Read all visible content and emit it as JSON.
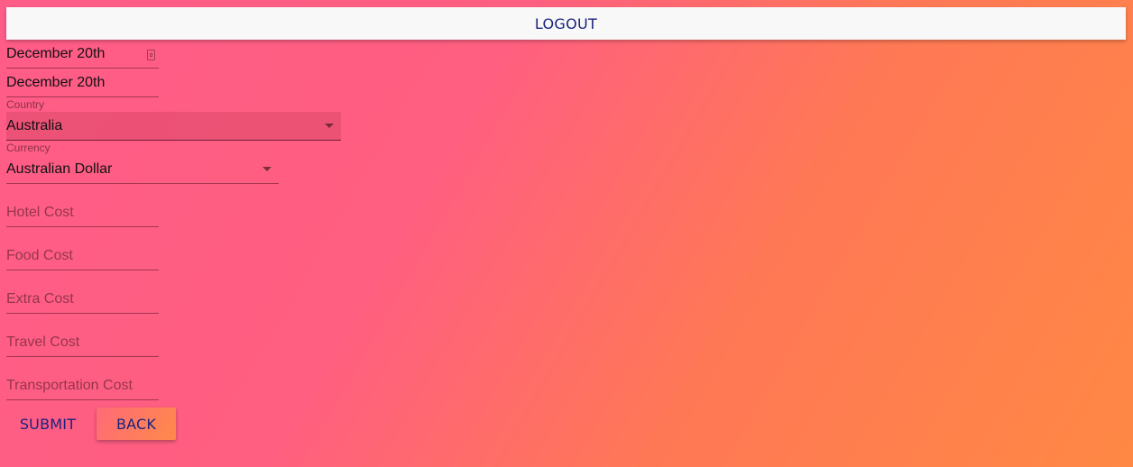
{
  "header": {
    "logout_label": "LOGOUT"
  },
  "form": {
    "start_date": "December 20th",
    "end_date": "December 20th",
    "country": {
      "label": "Country",
      "value": "Australia"
    },
    "currency": {
      "label": "Currency",
      "value": "Australian Dollar"
    },
    "hotel_cost": {
      "placeholder": "Hotel Cost"
    },
    "food_cost": {
      "placeholder": "Food Cost"
    },
    "extra_cost": {
      "placeholder": "Extra Cost"
    },
    "travel_cost": {
      "placeholder": "Travel Cost"
    },
    "transportation_cost": {
      "placeholder": "Transportation Cost"
    }
  },
  "actions": {
    "submit_label": "SUBMIT",
    "back_label": "BACK"
  },
  "icons": {
    "calendar": "calendar-icon",
    "dropdown": "chevron-down-icon"
  },
  "colors": {
    "button_text": "#1a237e",
    "gradient_start": "#ff5c88",
    "gradient_end": "#ff8844"
  }
}
